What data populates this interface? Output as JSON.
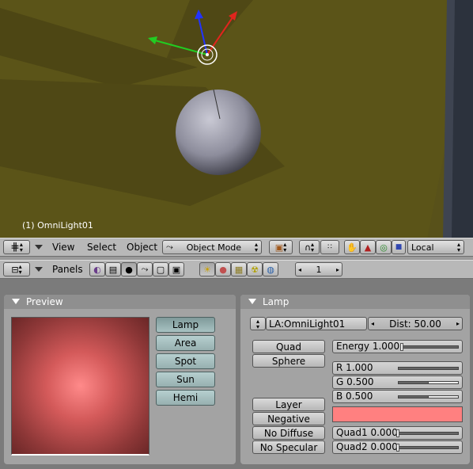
{
  "viewport": {
    "object_label": "(1) OmniLight01"
  },
  "view_header": {
    "menus": [
      "View",
      "Select",
      "Object"
    ],
    "mode_label": "Object Mode",
    "orientation_label": "Local"
  },
  "buttons_header": {
    "panels_label": "Panels",
    "frame_value": "1"
  },
  "preview_panel": {
    "title": "Preview",
    "lamp_types": [
      "Lamp",
      "Area",
      "Spot",
      "Sun",
      "Hemi"
    ],
    "selected_lamp_type": "Lamp",
    "preview_color": "#ff8a8a"
  },
  "lamp_panel": {
    "title": "Lamp",
    "name_field": "LA:OmniLight01",
    "dist_label": "Dist: 50.00",
    "quad_label": "Quad",
    "sphere_label": "Sphere",
    "energy_label": "Energy 1.000",
    "energy_fraction": 0.0,
    "r_label": "R 1.000",
    "r_value": 1.0,
    "g_label": "G 0.500",
    "g_value": 0.5,
    "b_label": "B 0.500",
    "b_value": 0.5,
    "layer_label": "Layer",
    "negative_label": "Negative",
    "no_diffuse_label": "No Diffuse",
    "no_specular_label": "No Specular",
    "color_swatch": "#ff8080",
    "quad1_label": "Quad1 0.000",
    "quad1_value": 0.0,
    "quad2_label": "Quad2 0.000",
    "quad2_value": 0.0
  }
}
